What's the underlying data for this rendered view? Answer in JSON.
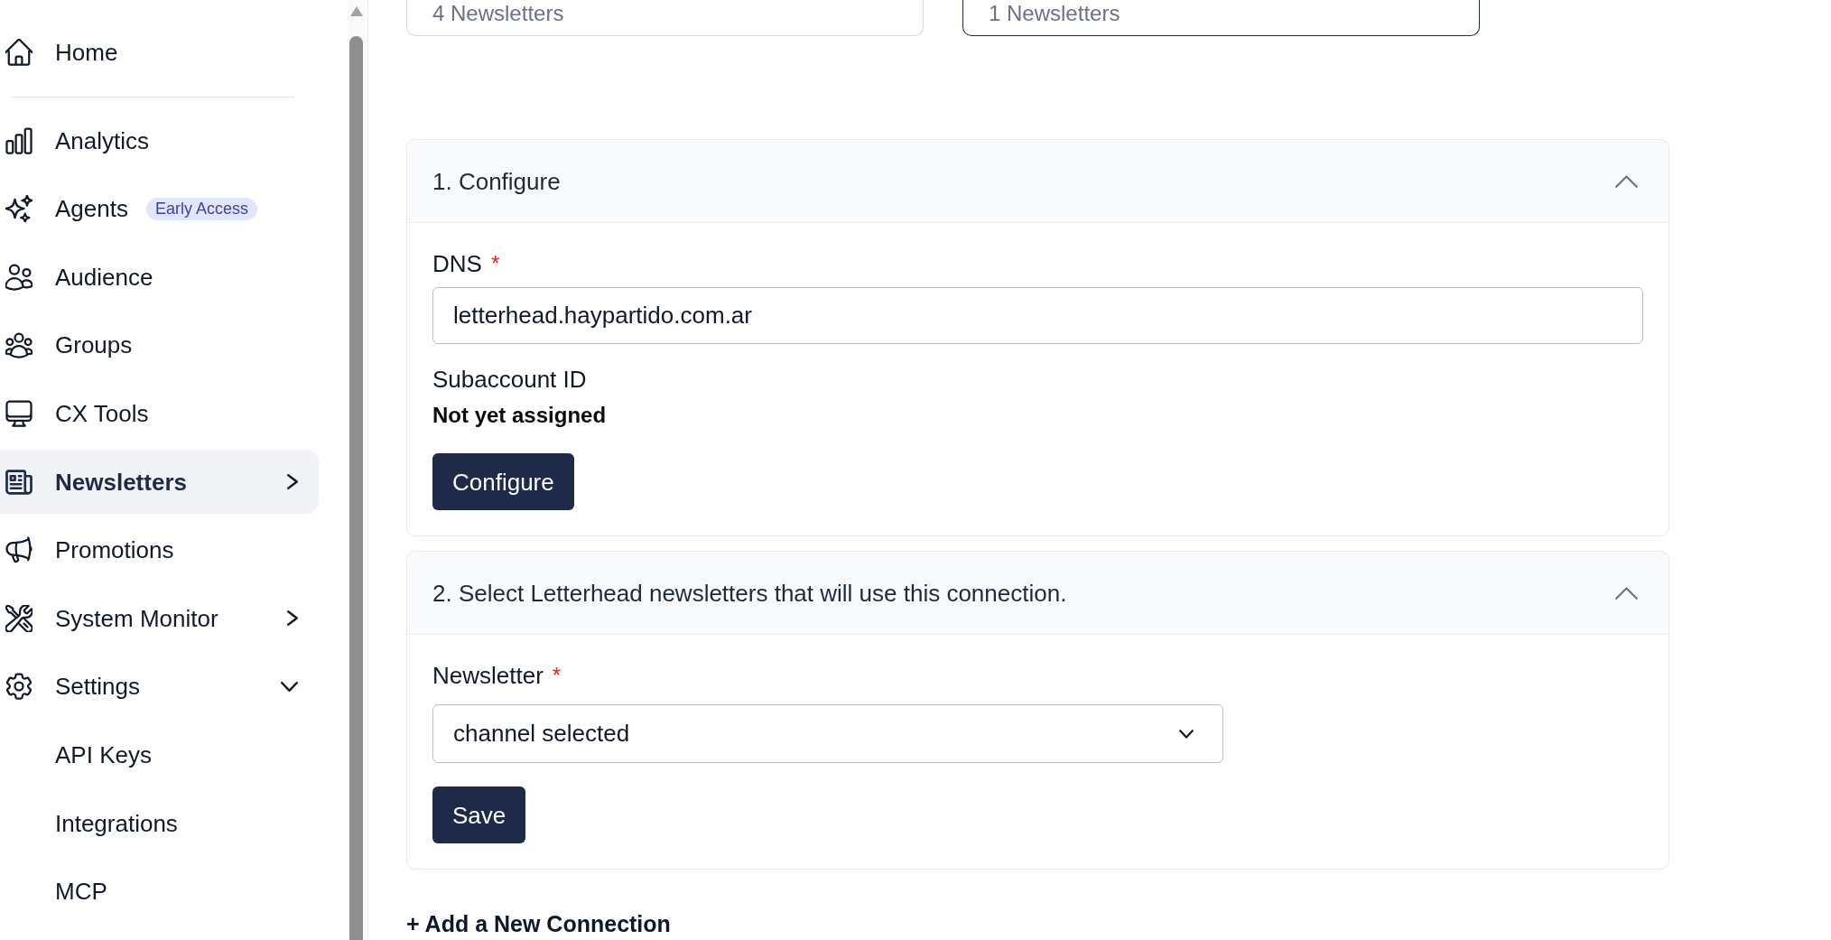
{
  "sidebar": {
    "items": [
      {
        "kind": "link",
        "label": "Home",
        "selected": false
      },
      {
        "kind": "divider"
      },
      {
        "kind": "link",
        "label": "Analytics",
        "selected": false
      },
      {
        "kind": "link",
        "label": "Agents",
        "badge": "Early Access",
        "selected": false
      },
      {
        "kind": "link",
        "label": "Audience",
        "selected": false
      },
      {
        "kind": "link",
        "label": "Groups",
        "selected": false
      },
      {
        "kind": "link",
        "label": "CX Tools",
        "selected": false
      },
      {
        "kind": "group",
        "label": "Newsletters",
        "selected": true,
        "expanded": false
      },
      {
        "kind": "link",
        "label": "Promotions",
        "selected": false
      },
      {
        "kind": "group",
        "label": "System Monitor",
        "selected": false,
        "expanded": false
      },
      {
        "kind": "group",
        "label": "Settings",
        "selected": false,
        "expanded": true,
        "children": [
          {
            "label": "API Keys",
            "selected": false
          },
          {
            "label": "Integrations",
            "selected": false
          },
          {
            "label": "MCP",
            "selected": false
          }
        ]
      }
    ]
  },
  "summary_cards": [
    {
      "label": "4 Newsletters",
      "selected": false
    },
    {
      "label": "1 Newsletters",
      "selected": true
    }
  ],
  "sections": [
    {
      "title": "1. Configure",
      "expanded": true,
      "fields": [
        {
          "kind": "text",
          "label": "DNS",
          "required_mark": "*",
          "value": "letterhead.haypartido.com.ar"
        },
        {
          "kind": "readonly",
          "label": "Subaccount ID",
          "value": "Not yet assigned"
        }
      ],
      "button": "Configure"
    },
    {
      "title": "2. Select Letterhead newsletters that will use this connection.",
      "expanded": true,
      "fields": [
        {
          "kind": "select",
          "label": "Newsletter",
          "required_mark": "*",
          "value": "channel selected"
        }
      ],
      "button": "Save"
    }
  ],
  "add_connection": "+ Add a New Connection"
}
